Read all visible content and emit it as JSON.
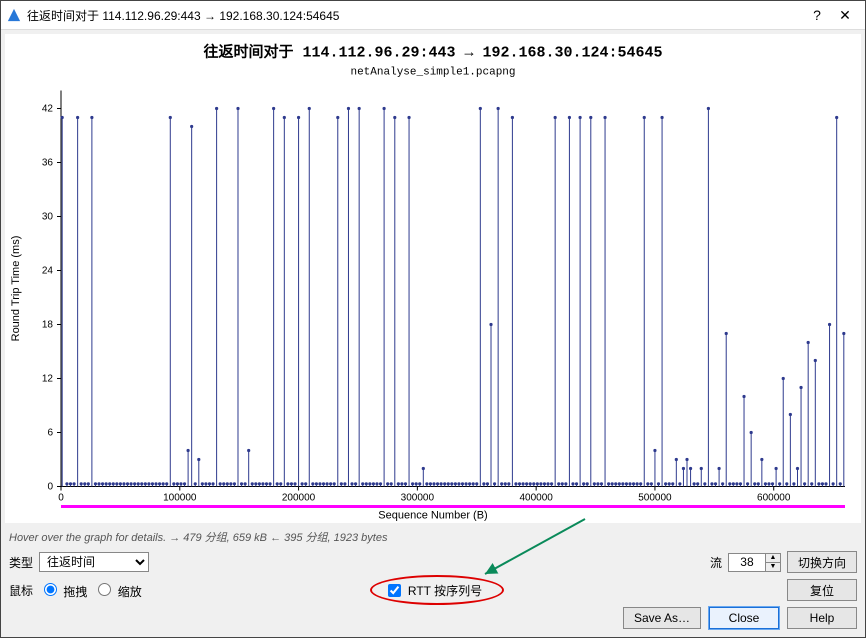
{
  "window": {
    "title": "往返时间对于 114.112.96.29:443 → 192.168.30.124:54645",
    "help_btn": "?",
    "close_btn": "✕"
  },
  "chart_data": {
    "type": "scatter",
    "title": "往返时间对于 114.112.96.29:443 → 192.168.30.124:54645",
    "subtitle": "netAnalyse_simple1.pcapng",
    "xlabel": "Sequence Number (B)",
    "ylabel": "Round Trip Time (ms)",
    "xlim": [
      0,
      660000
    ],
    "ylim": [
      0,
      44
    ],
    "xticks": [
      0,
      100000,
      200000,
      300000,
      400000,
      500000,
      600000
    ],
    "yticks": [
      0,
      6,
      12,
      18,
      24,
      30,
      36,
      42
    ],
    "series": [
      {
        "name": "RTT",
        "color": "#2e3a8e",
        "x": [
          1000,
          5000,
          8000,
          11000,
          14000,
          17000,
          20000,
          23000,
          26000,
          29000,
          32000,
          35000,
          38000,
          41000,
          44000,
          47000,
          50000,
          53000,
          56000,
          59000,
          62000,
          65000,
          68000,
          71000,
          74000,
          77000,
          80000,
          83000,
          86000,
          89000,
          92000,
          95000,
          98000,
          101000,
          104000,
          107000,
          110000,
          113000,
          116000,
          119000,
          122000,
          125000,
          128000,
          131000,
          134000,
          137000,
          140000,
          143000,
          146000,
          149000,
          152000,
          155000,
          158000,
          161000,
          164000,
          167000,
          170000,
          173000,
          176000,
          179000,
          182000,
          185000,
          188000,
          191000,
          194000,
          197000,
          200000,
          203000,
          206000,
          209000,
          212000,
          215000,
          218000,
          221000,
          224000,
          227000,
          230000,
          233000,
          236000,
          239000,
          242000,
          245000,
          248000,
          251000,
          254000,
          257000,
          260000,
          263000,
          266000,
          269000,
          272000,
          275000,
          278000,
          281000,
          284000,
          287000,
          290000,
          293000,
          296000,
          299000,
          302000,
          305000,
          308000,
          311000,
          314000,
          317000,
          320000,
          323000,
          326000,
          329000,
          332000,
          335000,
          338000,
          341000,
          344000,
          347000,
          350000,
          353000,
          356000,
          359000,
          362000,
          365000,
          368000,
          371000,
          374000,
          377000,
          380000,
          383000,
          386000,
          389000,
          392000,
          395000,
          398000,
          401000,
          404000,
          407000,
          410000,
          413000,
          416000,
          419000,
          422000,
          425000,
          428000,
          431000,
          434000,
          437000,
          440000,
          443000,
          446000,
          449000,
          452000,
          455000,
          458000,
          461000,
          464000,
          467000,
          470000,
          473000,
          476000,
          479000,
          482000,
          485000,
          488000,
          491000,
          494000,
          497000,
          500000,
          503000,
          506000,
          509000,
          512000,
          515000,
          518000,
          521000,
          524000,
          527000,
          530000,
          533000,
          536000,
          539000,
          542000,
          545000,
          548000,
          551000,
          554000,
          557000,
          560000,
          563000,
          566000,
          569000,
          572000,
          575000,
          578000,
          581000,
          584000,
          587000,
          590000,
          593000,
          596000,
          599000,
          602000,
          605000,
          608000,
          611000,
          614000,
          617000,
          620000,
          623000,
          626000,
          629000,
          632000,
          635000,
          638000,
          641000,
          644000,
          647000,
          650000,
          653000,
          656000,
          659000
        ],
        "y": [
          41,
          0.3,
          0.3,
          0.3,
          41,
          0.3,
          0.3,
          0.3,
          41,
          0.3,
          0.3,
          0.3,
          0.3,
          0.3,
          0.3,
          0.3,
          0.3,
          0.3,
          0.3,
          0.3,
          0.3,
          0.3,
          0.3,
          0.3,
          0.3,
          0.3,
          0.3,
          0.3,
          0.3,
          0.3,
          41,
          0.3,
          0.3,
          0.3,
          0.3,
          4,
          40,
          0.3,
          3,
          0.3,
          0.3,
          0.3,
          0.3,
          42,
          0.3,
          0.3,
          0.3,
          0.3,
          0.3,
          42,
          0.3,
          0.3,
          4,
          0.3,
          0.3,
          0.3,
          0.3,
          0.3,
          0.3,
          42,
          0.3,
          0.3,
          41,
          0.3,
          0.3,
          0.3,
          41,
          0.3,
          0.3,
          42,
          0.3,
          0.3,
          0.3,
          0.3,
          0.3,
          0.3,
          0.3,
          41,
          0.3,
          0.3,
          42,
          0.3,
          0.3,
          42,
          0.3,
          0.3,
          0.3,
          0.3,
          0.3,
          0.3,
          42,
          0.3,
          0.3,
          41,
          0.3,
          0.3,
          0.3,
          41,
          0.3,
          0.3,
          0.3,
          2,
          0.3,
          0.3,
          0.3,
          0.3,
          0.3,
          0.3,
          0.3,
          0.3,
          0.3,
          0.3,
          0.3,
          0.3,
          0.3,
          0.3,
          0.3,
          42,
          0.3,
          0.3,
          18,
          0.3,
          42,
          0.3,
          0.3,
          0.3,
          41,
          0.3,
          0.3,
          0.3,
          0.3,
          0.3,
          0.3,
          0.3,
          0.3,
          0.3,
          0.3,
          0.3,
          41,
          0.3,
          0.3,
          0.3,
          41,
          0.3,
          0.3,
          41,
          0.3,
          0.3,
          41,
          0.3,
          0.3,
          0.3,
          41,
          0.3,
          0.3,
          0.3,
          0.3,
          0.3,
          0.3,
          0.3,
          0.3,
          0.3,
          0.3,
          41,
          0.3,
          0.3,
          4,
          0.3,
          41,
          0.3,
          0.3,
          0.3,
          3,
          0.3,
          2,
          3,
          2,
          0.3,
          0.3,
          2,
          0.3,
          42,
          0.3,
          0.3,
          2,
          0.3,
          17,
          0.3,
          0.3,
          0.3,
          0.3,
          10,
          0.3,
          6,
          0.3,
          0.3,
          3,
          0.3,
          0.3,
          0.3,
          2,
          0.3,
          12,
          0.3,
          8,
          0.3,
          2,
          11,
          0.3,
          16,
          0.3,
          14,
          0.3,
          0.3,
          0.3,
          18,
          0.3,
          41,
          0.3,
          17
        ]
      }
    ],
    "baseline_bar": {
      "color": "#ff00ff",
      "y": 0,
      "thickness": 3
    }
  },
  "status_text": "Hover over the graph for details. → 479 分组, 659 kB ← 395 分组, 1923 bytes",
  "controls": {
    "type_label": "类型",
    "type_value": "往返时间",
    "mouse_label": "鼠标",
    "radio_drag": "拖拽",
    "radio_zoom": "缩放",
    "rtt_checkbox": "RTT 按序列号",
    "stream_label": "流",
    "stream_value": "38",
    "switch_dir": "切换方向",
    "reset": "复位",
    "save_as": "Save As…",
    "close": "Close",
    "help": "Help"
  }
}
